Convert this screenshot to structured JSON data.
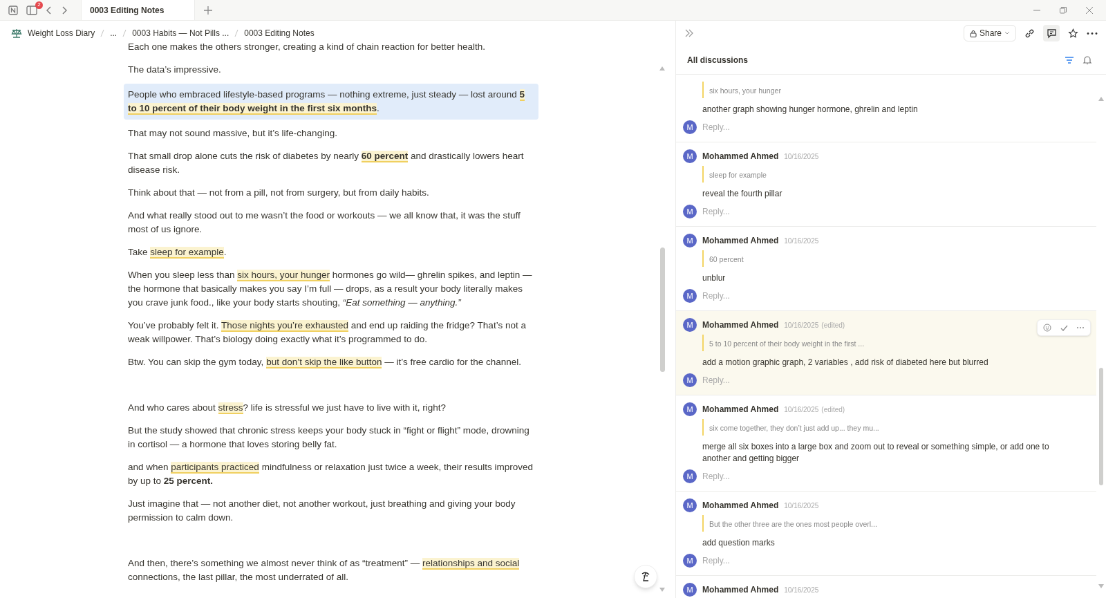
{
  "tabs": [
    {
      "label": "0003 Editing Notes",
      "selected": true
    }
  ],
  "sidebar_badge": "2",
  "breadcrumbs": [
    "Weight Loss Diary",
    "...",
    "0003 Habits — Not Pills ...",
    "0003 Editing Notes"
  ],
  "document": {
    "paragraphs": [
      {
        "selected": false,
        "segments": [
          {
            "text": "Each one makes the others stronger, creating a kind of chain reaction for better health.",
            "kind": "plain"
          }
        ]
      },
      {
        "selected": false,
        "segments": [
          {
            "text": "The data’s impressive.",
            "kind": "plain"
          }
        ]
      },
      {
        "selected": true,
        "segments": [
          {
            "text": "People who embraced lifestyle-based programs — nothing extreme, just steady — lost around ",
            "kind": "plain"
          },
          {
            "text": "5 to 10 percent of their body weight in the first six months",
            "kind": "bold_highlight"
          },
          {
            "text": ".",
            "kind": "plain"
          }
        ]
      },
      {
        "selected": false,
        "segments": [
          {
            "text": "That may not sound massive, but it’s life-changing.",
            "kind": "plain"
          }
        ]
      },
      {
        "selected": false,
        "segments": [
          {
            "text": "That small drop alone cuts the risk of diabetes by nearly ",
            "kind": "plain"
          },
          {
            "text": "60 percent",
            "kind": "bold_highlight"
          },
          {
            "text": " and drastically lowers heart disease risk.",
            "kind": "plain"
          }
        ]
      },
      {
        "selected": false,
        "segments": [
          {
            "text": "Think about that — not from a pill, not from surgery, but from daily habits.",
            "kind": "plain"
          }
        ]
      },
      {
        "selected": false,
        "segments": [
          {
            "text": "And what really stood out to me wasn’t the food or workouts — we all know that,  it was the stuff most of us ignore.",
            "kind": "plain"
          }
        ]
      },
      {
        "selected": false,
        "segments": [
          {
            "text": "Take ",
            "kind": "plain"
          },
          {
            "text": "sleep for example",
            "kind": "highlight"
          },
          {
            "text": ".",
            "kind": "plain"
          }
        ]
      },
      {
        "selected": false,
        "segments": [
          {
            "text": "When you sleep less than ",
            "kind": "plain"
          },
          {
            "text": "six hours, your hunger",
            "kind": "highlight"
          },
          {
            "text": " hormones go wild— ghrelin spikes, and leptin — the hormone that basically makes you say I’m full — drops, as a result  your body literally makes you crave junk food.,  like your body starts shouting, ",
            "kind": "plain"
          },
          {
            "text": "“Eat something — anything.”",
            "kind": "italic"
          }
        ]
      },
      {
        "selected": false,
        "segments": [
          {
            "text": "You’ve probably felt it. ",
            "kind": "plain"
          },
          {
            "text": "Those nights you’re exhausted",
            "kind": "highlight"
          },
          {
            "text": " and end up raiding the fridge? That’s not a weak willpower. That’s biology doing exactly what it’s programmed to do.",
            "kind": "plain"
          }
        ]
      },
      {
        "selected": false,
        "segments": [
          {
            "text": "Btw. You can skip the gym today, ",
            "kind": "plain"
          },
          {
            "text": "but don’t skip the like button",
            "kind": "highlight"
          },
          {
            "text": " — it’s free cardio for the channel.",
            "kind": "plain"
          }
        ]
      },
      {
        "selected": false,
        "gap_before": true,
        "segments": [
          {
            "text": "And who cares about ",
            "kind": "plain"
          },
          {
            "text": "stress",
            "kind": "highlight"
          },
          {
            "text": "? life is stressful we just have to live with it, right?",
            "kind": "plain"
          }
        ]
      },
      {
        "selected": false,
        "segments": [
          {
            "text": "But the study showed that chronic stress keeps your body stuck in “fight or flight” mode, drowning in cortisol — a hormone that loves storing belly fat.",
            "kind": "plain"
          }
        ]
      },
      {
        "selected": false,
        "segments": [
          {
            "text": "and when ",
            "kind": "plain"
          },
          {
            "text": "participants practiced",
            "kind": "highlight"
          },
          {
            "text": " mindfulness or relaxation just twice a week, their results improved by up to ",
            "kind": "plain"
          },
          {
            "text": "25 percent.",
            "kind": "bold"
          }
        ]
      },
      {
        "selected": false,
        "segments": [
          {
            "text": "Just imagine that — not another diet, not another workout, just breathing and giving your body permission to calm down.",
            "kind": "plain"
          }
        ]
      },
      {
        "selected": false,
        "gap_before": true,
        "segments": [
          {
            "text": "And then, there’s something we almost never think of as “treatment” — ",
            "kind": "plain"
          },
          {
            "text": "relationships and social",
            "kind": "highlight"
          },
          {
            "text": " connections, the last pillar,  the most underrated of all.",
            "kind": "plain"
          }
        ]
      }
    ]
  },
  "share_button": "Share",
  "discussions": {
    "title": "All discussions",
    "threads": [
      {
        "selected": false,
        "quote": "six hours, your hunger",
        "body": "another graph showing hunger hormone, ghrelin and leptin",
        "reply_avatar": "M",
        "reply_placeholder": "Reply..."
      },
      {
        "selected": false,
        "avatar": "M",
        "author": "Mohammed Ahmed",
        "date": "10/16/2025",
        "quote": "sleep for example",
        "body": "reveal the fourth pillar",
        "reply_avatar": "M",
        "reply_placeholder": "Reply..."
      },
      {
        "selected": false,
        "avatar": "M",
        "author": "Mohammed Ahmed",
        "date": "10/16/2025",
        "quote": "60 percent",
        "body": "unblur",
        "reply_avatar": "M",
        "reply_placeholder": "Reply..."
      },
      {
        "selected": true,
        "avatar": "M",
        "author": "Mohammed Ahmed",
        "date": "10/16/2025",
        "edited": "(edited)",
        "quote": "5 to 10 percent of their body weight in the first ...",
        "body": "add a motion graphic graph, 2 variables , add risk of diabeted here but blurred",
        "reply_avatar": "M",
        "reply_placeholder": "Reply..."
      },
      {
        "selected": false,
        "avatar": "M",
        "author": "Mohammed Ahmed",
        "date": "10/16/2025",
        "edited": "(edited)",
        "quote": "six come together, they don’t just add up... they mu...",
        "body": "merge all six boxes into a large box and zoom out to reveal or something simple, or add one to another and getting bigger",
        "reply_avatar": "M",
        "reply_placeholder": "Reply..."
      },
      {
        "selected": false,
        "avatar": "M",
        "author": "Mohammed Ahmed",
        "date": "10/16/2025",
        "quote": "But the other three are the ones most people overl...",
        "body": "add question marks",
        "reply_avatar": "M",
        "reply_placeholder": "Reply..."
      },
      {
        "selected": false,
        "avatar": "M",
        "author": "Mohammed Ahmed",
        "date": "10/16/2025"
      }
    ]
  }
}
